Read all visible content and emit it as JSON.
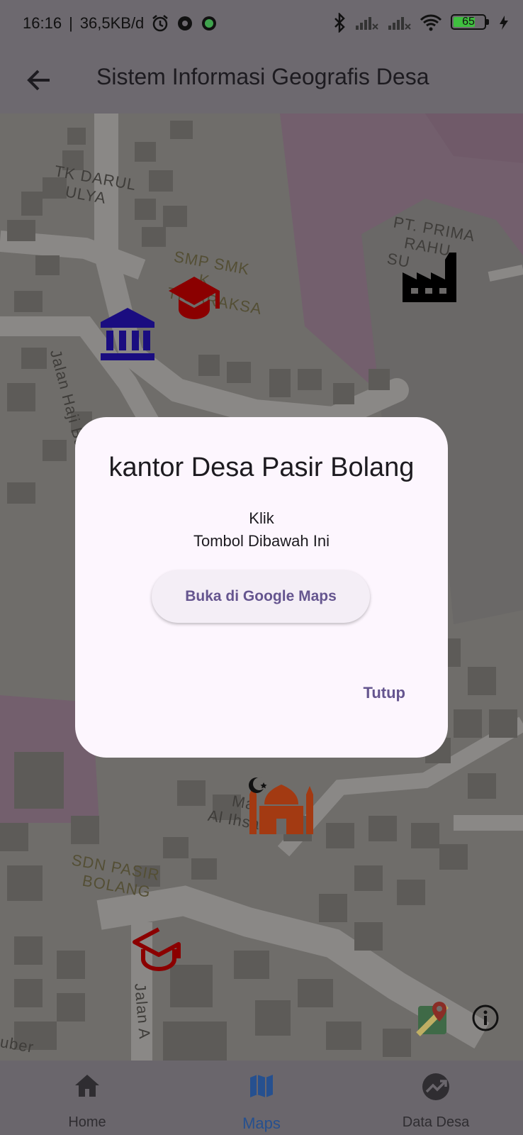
{
  "status_bar": {
    "time": "16:16",
    "speed": "36,5KB/d",
    "battery": "65"
  },
  "app_bar": {
    "title": "Sistem Informasi Geografis Desa"
  },
  "map": {
    "labels": {
      "tk": [
        "TK DARUL",
        "ULYA"
      ],
      "smp": [
        "SMP SMK",
        "K",
        "TIGARAKSA"
      ],
      "pt": [
        "PT. PRIMA",
        "RAHU",
        "SU"
      ],
      "jalan_haji": "Jalan Haji Basar",
      "masjid": [
        "Ma",
        "Al Ihsania"
      ],
      "sdn": [
        "SDN PASIR",
        "BOLANG"
      ],
      "jalan_a": "Jalan A",
      "uber": "uber"
    },
    "marker_colors": {
      "school": "#8b0000",
      "office": "#1a0d80",
      "factory": "#000000",
      "mosque": "#a33a12"
    }
  },
  "dialog": {
    "title": "kantor Desa Pasir Bolang",
    "line1": "Klik",
    "line2": "Tombol Dibawah Ini",
    "open_button": "Buka di Google Maps",
    "close_button": "Tutup"
  },
  "bottom_nav": {
    "items": [
      {
        "label": "Home",
        "icon": "home-icon"
      },
      {
        "label": "Maps",
        "icon": "map-icon"
      },
      {
        "label": "Data Desa",
        "icon": "chart-icon"
      }
    ],
    "active": "Maps"
  }
}
